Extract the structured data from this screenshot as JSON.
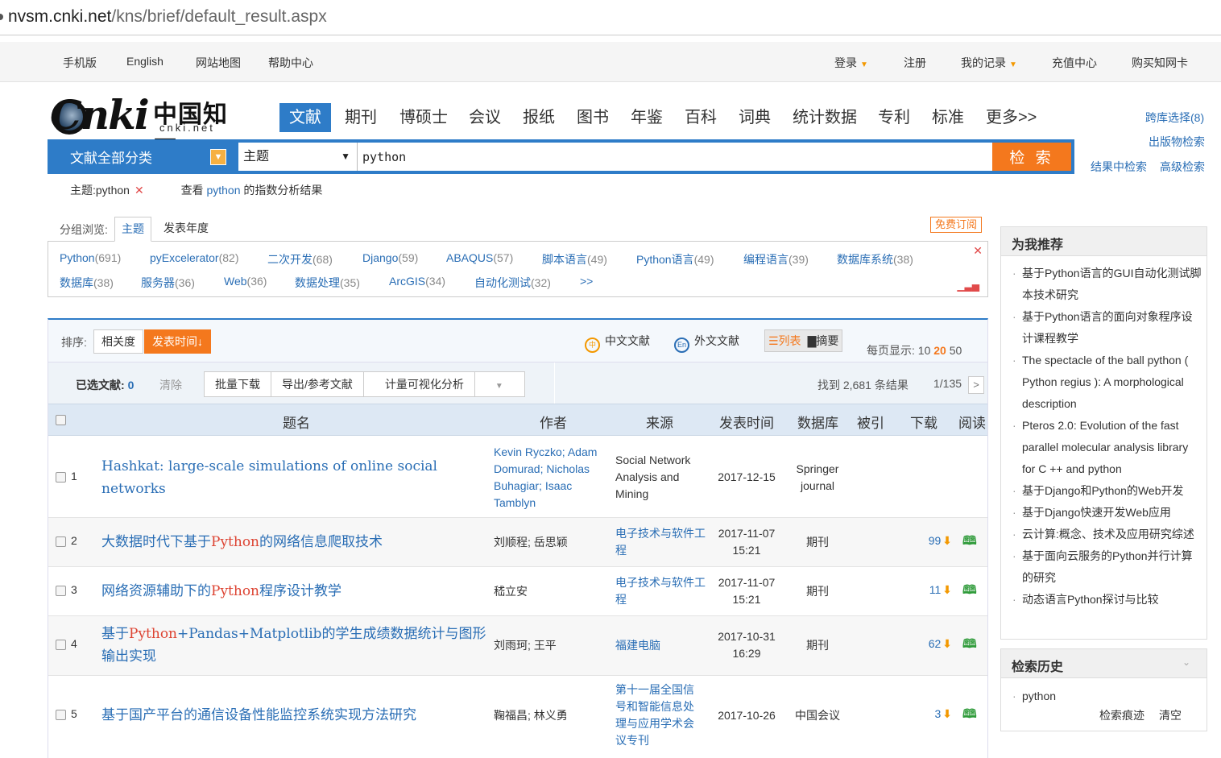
{
  "browser": {
    "url_host": "nvsm.cnki.net",
    "url_path": "/kns/brief/default_result.aspx"
  },
  "topnav": {
    "left": [
      "手机版",
      "English",
      "网站地图",
      "帮助中心"
    ],
    "login": "登录",
    "register": "注册",
    "my_records": "我的记录",
    "recharge": "充值中心",
    "buy_card": "购买知网卡"
  },
  "logo": {
    "brand": "Cnki",
    "chinese": "中国知网",
    "domain": "cnki.net"
  },
  "db_tabs": [
    "文献",
    "期刊",
    "博硕士",
    "会议",
    "报纸",
    "图书",
    "年鉴",
    "百科",
    "词典",
    "统计数据",
    "专利",
    "标准",
    "更多>>"
  ],
  "right_links": {
    "cross": "跨库选择(8)",
    "pub_search": "出版物检索",
    "in_result": "结果中检索",
    "advanced": "高级检索"
  },
  "search": {
    "category": "文献全部分类",
    "field": "主题",
    "keyword": "python",
    "button": "检 索"
  },
  "crumbs": {
    "tag": "主题:python",
    "remove": "✕",
    "index_prefix": "查看",
    "index_kw": "python",
    "index_suffix": "的指数分析结果"
  },
  "group": {
    "label": "分组浏览:",
    "tab_subject": "主题",
    "tab_year": "发表年度",
    "free_sub": "免费订阅"
  },
  "topics": [
    {
      "name": "Python",
      "count": "(691)"
    },
    {
      "name": "pyExcelerator",
      "count": "(82)"
    },
    {
      "name": "二次开发",
      "count": "(68)"
    },
    {
      "name": "Django",
      "count": "(59)"
    },
    {
      "name": "ABAQUS",
      "count": "(57)"
    },
    {
      "name": "脚本语言",
      "count": "(49)"
    },
    {
      "name": "Python语言",
      "count": "(49)"
    },
    {
      "name": "编程语言",
      "count": "(39)"
    },
    {
      "name": "数据库系统",
      "count": "(38)"
    },
    {
      "name": "数据库",
      "count": "(38)"
    },
    {
      "name": "服务器",
      "count": "(36)"
    },
    {
      "name": "Web",
      "count": "(36)"
    },
    {
      "name": "数据处理",
      "count": "(35)"
    },
    {
      "name": "ArcGIS",
      "count": "(34)"
    },
    {
      "name": "自动化测试",
      "count": "(32)"
    },
    {
      "name": ">>",
      "count": ""
    }
  ],
  "sort": {
    "label": "排序:",
    "relevance": "相关度",
    "pubtime": "发表时间↓",
    "zh": "中文文献",
    "foreign": "外文文献",
    "view_list": "☰列表",
    "view_abstract": "▇摘要",
    "perpage_label": "每页显示:",
    "perpage": [
      "10",
      "20",
      "50"
    ]
  },
  "selbar": {
    "selected_label": "已选文献:",
    "selected_count": "0",
    "clear": "清除",
    "batch": "批量下载",
    "export": "导出/参考文献",
    "visual": "计量可视化分析",
    "found": "找到 2,681 条结果",
    "page": "1/135",
    "next": ">"
  },
  "table": {
    "headers": [
      "题名",
      "作者",
      "来源",
      "发表时间",
      "数据库",
      "被引",
      "下载",
      "阅读"
    ],
    "rows": [
      {
        "num": "1",
        "title_pre": "Hashkat: large-scale simulations of online social networks",
        "title_hl": "",
        "title_post": "",
        "author": "Kevin Ryczko; Adam Domurad; Nicholas Buhagiar; Isaac Tamblyn",
        "source": "Social Network Analysis and Mining",
        "date": "2017-12-15",
        "db": "Springer journal",
        "downloads": "",
        "read": ""
      },
      {
        "num": "2",
        "title_pre": "大数据时代下基于",
        "title_hl": "Python",
        "title_post": "的网络信息爬取技术",
        "author": "刘顺程; 岳思颖",
        "source": "电子技术与软件工程",
        "date": "2017-11-07 15:21",
        "db": "期刊",
        "downloads": "99",
        "read": "🕮"
      },
      {
        "num": "3",
        "title_pre": "网络资源辅助下的",
        "title_hl": "Python",
        "title_post": "程序设计教学",
        "author": "嵇立安",
        "source": "电子技术与软件工程",
        "date": "2017-11-07 15:21",
        "db": "期刊",
        "downloads": "11",
        "read": "🕮"
      },
      {
        "num": "4",
        "title_pre": "基于",
        "title_hl": "Python",
        "title_post": "+Pandas+Matplotlib的学生成绩数据统计与图形输出实现",
        "author": "刘雨珂; 王平",
        "source": "福建电脑",
        "date": "2017-10-31 16:29",
        "db": "期刊",
        "downloads": "62",
        "read": "🕮"
      },
      {
        "num": "5",
        "title_pre": "基于国产平台的通信设备性能监控系统实现方法研究",
        "title_hl": "",
        "title_post": "",
        "author": "鞠福昌; 林义勇",
        "source": "第十一届全国信号和智能信息处理与应用学术会议专刊",
        "date": "2017-10-26",
        "db": "中国会议",
        "downloads": "3",
        "read": "🕮"
      }
    ]
  },
  "sidebar": {
    "rec_title": "为我推荐",
    "recs": [
      "基于Python语言的GUI自动化测试脚本技术研究",
      "基于Python语言的面向对象程序设计课程教学",
      "The spectacle of the ball python ( Python regius ): A morphological description",
      "Pteros 2.0: Evolution of the fast parallel molecular analysis library for C ++ and python",
      "基于Django和Python的Web开发",
      "基于Django快速开发Web应用",
      "云计算:概念、技术及应用研究综述",
      "基于面向云服务的Python并行计算的研究",
      "动态语言Python探讨与比较"
    ],
    "hist_title": "检索历史",
    "hist_item": "python",
    "hist_trace": "检索痕迹",
    "hist_clear": "清空"
  }
}
